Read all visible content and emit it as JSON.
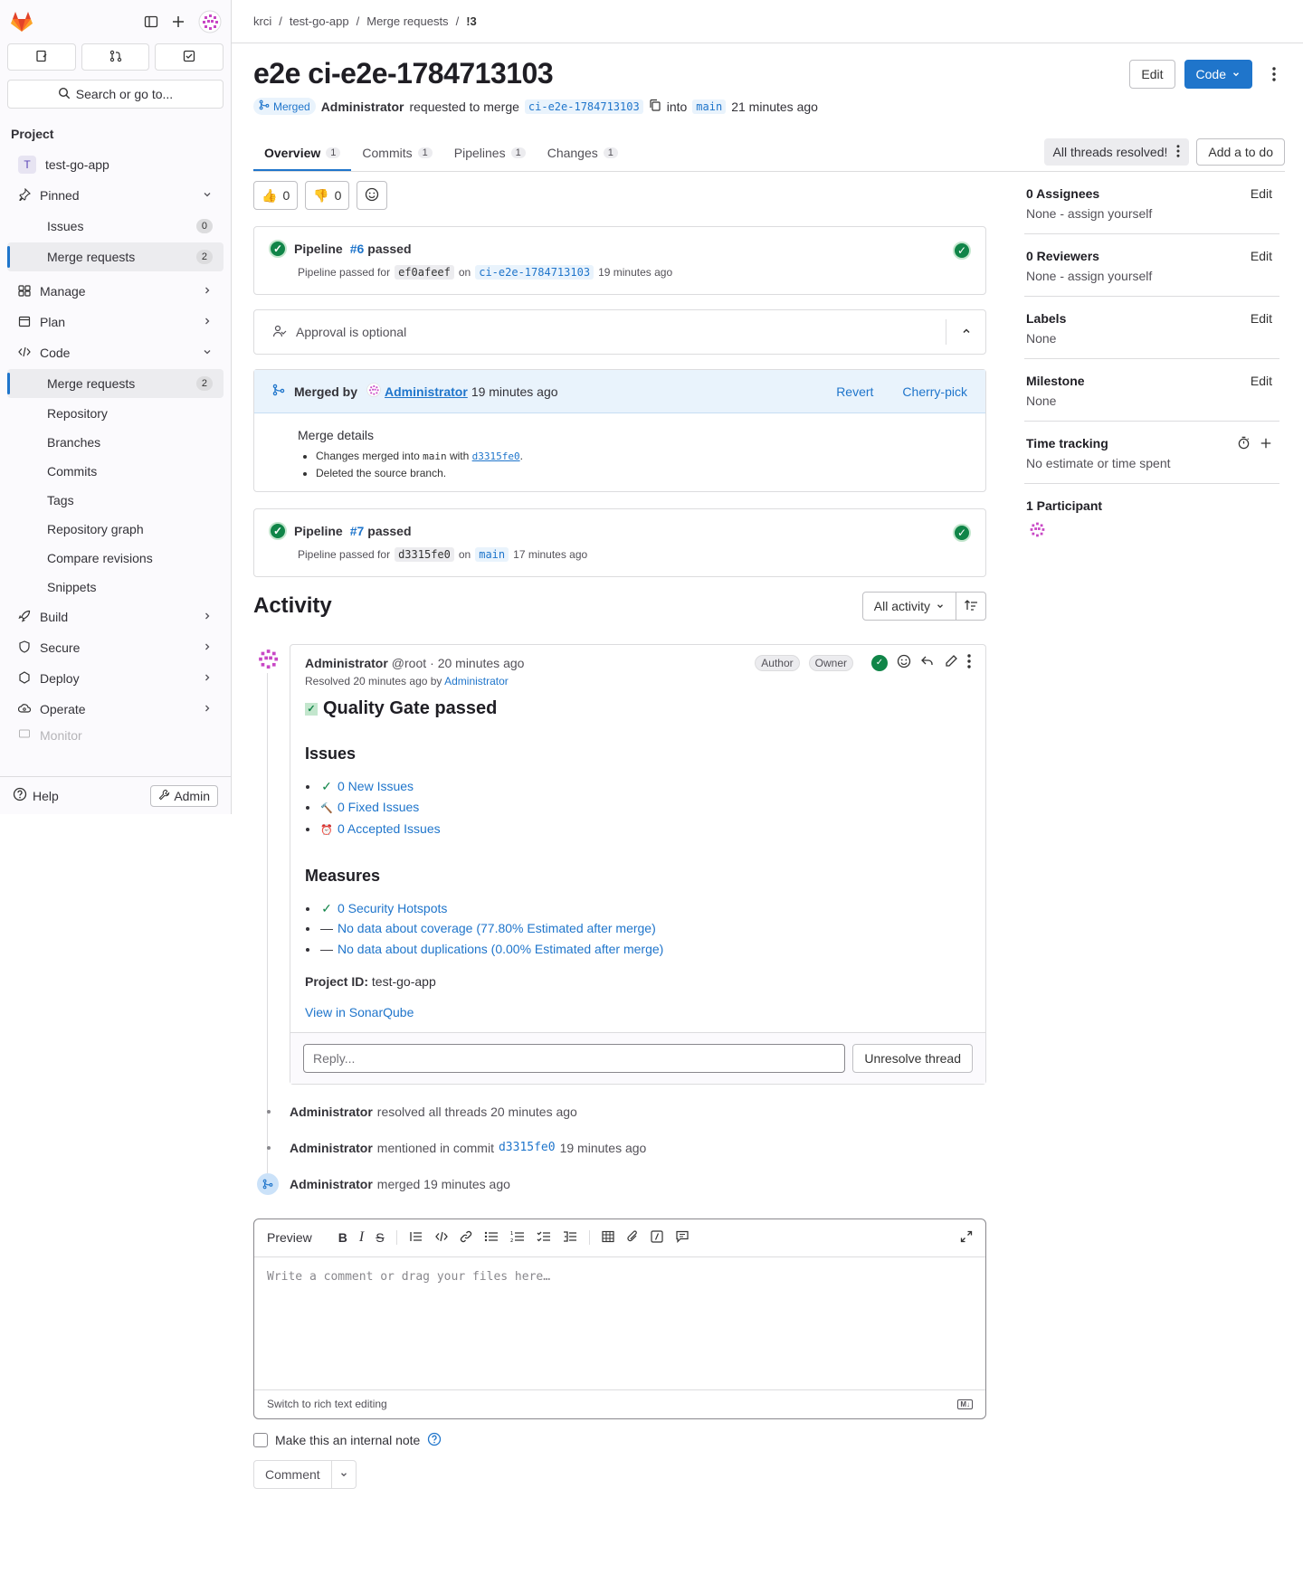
{
  "sidebar": {
    "counts_icons": [
      "issues-icon",
      "merge-request-icon",
      "todo-icon"
    ],
    "search_label": "Search or go to...",
    "section_title": "Project",
    "project_initial": "T",
    "project_name": "test-go-app",
    "pinned_label": "Pinned",
    "pinned_items": [
      {
        "label": "Issues",
        "count": "0"
      },
      {
        "label": "Merge requests",
        "count": "2"
      }
    ],
    "manage_label": "Manage",
    "plan_label": "Plan",
    "code_label": "Code",
    "code_items": [
      {
        "label": "Merge requests",
        "count": "2"
      },
      {
        "label": "Repository"
      },
      {
        "label": "Branches"
      },
      {
        "label": "Commits"
      },
      {
        "label": "Tags"
      },
      {
        "label": "Repository graph"
      },
      {
        "label": "Compare revisions"
      },
      {
        "label": "Snippets"
      }
    ],
    "build_label": "Build",
    "secure_label": "Secure",
    "deploy_label": "Deploy",
    "operate_label": "Operate",
    "monitor_label": "Monitor",
    "help_label": "Help",
    "admin_label": "Admin"
  },
  "breadcrumbs": [
    "krci",
    "test-go-app",
    "Merge requests",
    "!3"
  ],
  "mr": {
    "title": "e2e ci-e2e-1784713103",
    "edit_label": "Edit",
    "code_label": "Code",
    "status": "Merged",
    "author": "Administrator",
    "requested_text": "requested to merge",
    "source_branch": "ci-e2e-1784713103",
    "into_text": "into",
    "target_branch": "main",
    "time": "21 minutes ago"
  },
  "tabs": [
    {
      "label": "Overview",
      "count": "1"
    },
    {
      "label": "Commits",
      "count": "1"
    },
    {
      "label": "Pipelines",
      "count": "1"
    },
    {
      "label": "Changes",
      "count": "1"
    }
  ],
  "threads_resolved": "All threads resolved!",
  "add_todo": "Add a to do",
  "reactions": {
    "thumbs_up": "0",
    "thumbs_down": "0"
  },
  "pipeline1": {
    "prefix": "Pipeline",
    "id": "#6",
    "status": "passed",
    "sub": "Pipeline passed for",
    "commit": "ef0afeef",
    "on": "on",
    "branch": "ci-e2e-1784713103",
    "time": "19 minutes ago"
  },
  "approval": "Approval is optional",
  "merged": {
    "by_label": "Merged by",
    "user": "Administrator",
    "time": "19 minutes ago",
    "revert": "Revert",
    "cherry_pick": "Cherry-pick",
    "details_title": "Merge details",
    "line1_a": "Changes merged into",
    "line1_branch": "main",
    "line1_b": "with",
    "line1_commit": "d3315fe0",
    "line2": "Deleted the source branch."
  },
  "pipeline2": {
    "prefix": "Pipeline",
    "id": "#7",
    "status": "passed",
    "sub": "Pipeline passed for",
    "commit": "d3315fe0",
    "on": "on",
    "branch": "main",
    "time": "17 minutes ago"
  },
  "activity": {
    "title": "Activity",
    "filter": "All activity"
  },
  "note": {
    "author": "Administrator",
    "handle": "@root",
    "time": "· 20 minutes ago",
    "author_badge": "Author",
    "owner_badge": "Owner",
    "resolved_text": "Resolved 20 minutes ago by",
    "resolved_by": "Administrator",
    "qg_title": "Quality Gate passed",
    "issues_title": "Issues",
    "issues": [
      {
        "symbol": "✓",
        "text": "0 New Issues"
      },
      {
        "symbol": "🔨",
        "text": "0 Fixed Issues"
      },
      {
        "symbol": "⏰",
        "text": "0 Accepted Issues"
      }
    ],
    "measures_title": "Measures",
    "measures": [
      {
        "symbol": "✓",
        "text": "0 Security Hotspots"
      },
      {
        "symbol": "—",
        "text": "No data about coverage (77.80% Estimated after merge)"
      },
      {
        "symbol": "—",
        "text": "No data about duplications (0.00% Estimated after merge)"
      }
    ],
    "project_id_label": "Project ID:",
    "project_id": "test-go-app",
    "sonar_link": "View in SonarQube",
    "reply_placeholder": "Reply...",
    "unresolve": "Unresolve thread"
  },
  "system_notes": [
    {
      "user": "Administrator",
      "text": "resolved all threads 20 minutes ago"
    },
    {
      "user": "Administrator",
      "text": "mentioned in commit",
      "commit": "d3315fe0",
      "time": "19 minutes ago"
    },
    {
      "user": "Administrator",
      "text": "merged 19 minutes ago"
    }
  ],
  "editor": {
    "preview": "Preview",
    "placeholder": "Write a comment or drag your files here…",
    "rich_text": "Switch to rich text editing",
    "md_badge": "M↓"
  },
  "internal_note": "Make this an internal note",
  "comment_btn": "Comment",
  "right_sidebar": {
    "assignees_title": "0 Assignees",
    "assignees_value": "None - assign yourself",
    "reviewers_title": "0 Reviewers",
    "reviewers_value": "None - assign yourself",
    "labels_title": "Labels",
    "labels_value": "None",
    "milestone_title": "Milestone",
    "milestone_value": "None",
    "time_title": "Time tracking",
    "time_value": "No estimate or time spent",
    "participants_title": "1 Participant",
    "edit": "Edit"
  },
  "colors": {
    "accent": "#1f75cb",
    "success": "#108548",
    "brand": "#e24329"
  }
}
